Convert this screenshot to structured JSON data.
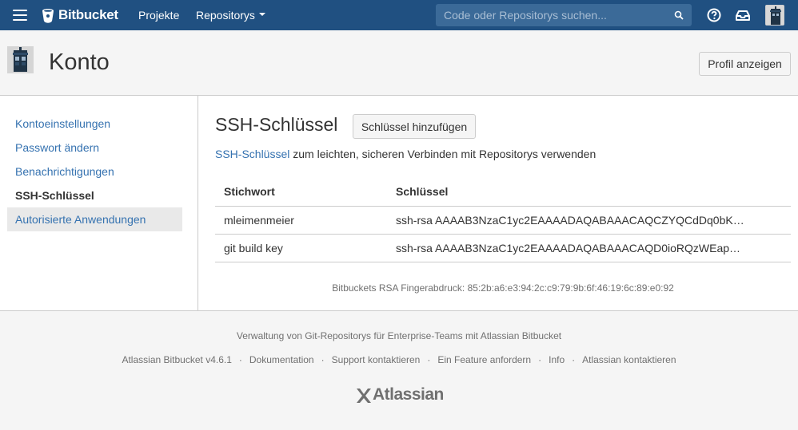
{
  "topnav": {
    "brand": "Bitbucket",
    "projects_label": "Projekte",
    "repos_label": "Repositorys",
    "search_placeholder": "Code oder Repositorys suchen..."
  },
  "header": {
    "title": "Konto",
    "profile_button": "Profil anzeigen"
  },
  "sidebar": {
    "items": [
      {
        "label": "Kontoeinstellungen"
      },
      {
        "label": "Passwort ändern"
      },
      {
        "label": "Benachrichtigungen"
      },
      {
        "label": "SSH-Schlüssel"
      },
      {
        "label": "Autorisierte Anwendungen"
      }
    ]
  },
  "main": {
    "title": "SSH-Schlüssel",
    "add_button": "Schlüssel hinzufügen",
    "desc_link": "SSH-Schlüssel",
    "desc_rest": " zum leichten, sicheren Verbinden mit Repositorys verwenden",
    "table": {
      "headers": [
        "Stichwort",
        "Schlüssel"
      ],
      "rows": [
        [
          "mleimenmeier",
          "ssh-rsa AAAAB3NzaC1yc2EAAAADAQABAAACAQCZYQCdDq0bK…"
        ],
        [
          "git build key",
          "ssh-rsa AAAAB3NzaC1yc2EAAAADAQABAAACAQD0ioRQzWEap…"
        ]
      ]
    },
    "fingerprint": "Bitbuckets RSA Fingerabdruck: 85:2b:a6:e3:94:2c:c9:79:9b:6f:46:19:6c:89:e0:92"
  },
  "footer": {
    "line1": "Verwaltung von Git-Repositorys für Enterprise-Teams mit Atlassian Bitbucket",
    "links": [
      "Atlassian Bitbucket v4.6.1",
      "Dokumentation",
      "Support kontaktieren",
      "Ein Feature anfordern",
      "Info",
      "Atlassian kontaktieren"
    ],
    "separator": "·",
    "logo_text": "Atlassian"
  },
  "colors": {
    "nav_bg": "#205081",
    "link": "#3572b0",
    "muted": "#707070"
  }
}
